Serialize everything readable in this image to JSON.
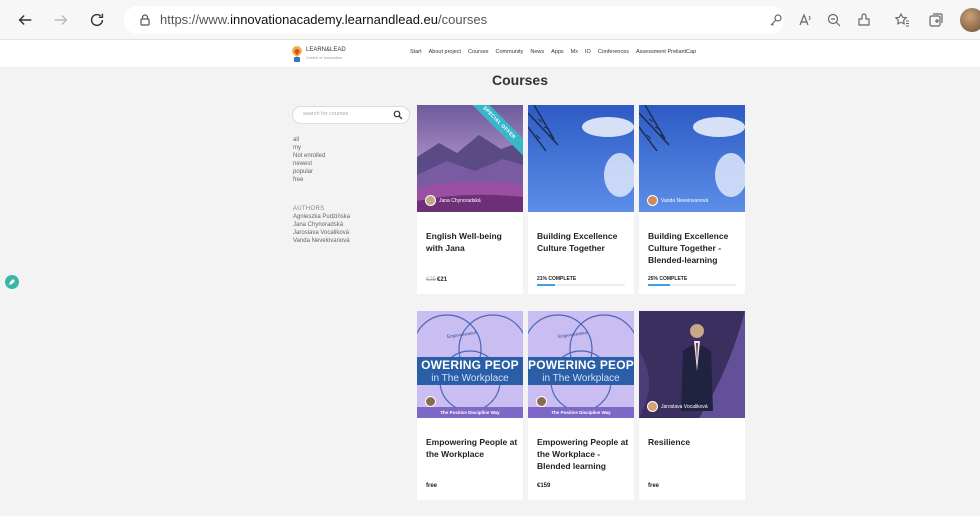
{
  "browser": {
    "url_prefix": "https://www.",
    "url_domain": "innovationacademy.learnandlead.eu",
    "url_path": "/courses"
  },
  "site": {
    "logo_name": "LEARN&LEAD",
    "logo_tagline": "Centre of Innovation",
    "menu": [
      "Start",
      "About project",
      "Courses",
      "Community",
      "News",
      "Apps",
      "Mx",
      "IO",
      "Conferences",
      "Assessment PreliantCap"
    ]
  },
  "page": {
    "title": "Courses",
    "search_placeholder": "search for courses",
    "filters": [
      "all",
      "my",
      "Not enrolled",
      "newest",
      "popular",
      "free"
    ],
    "authors_heading": "AUTHORS",
    "authors": [
      "Agnieszka Pudzińska",
      "Jana Chynoradská",
      "Jaroslava Vocaliková",
      "Vanda Nevelovanová"
    ]
  },
  "courses": [
    {
      "title": "English Well-being with Jana",
      "price_original": "€25",
      "price": "€21",
      "author": "Jana Chynoradská",
      "ribbon": "SPECIAL OFFER"
    },
    {
      "title": "Building Excellence Culture Together",
      "progress_label": "21% COMPLETE",
      "progress": 0.21
    },
    {
      "title": "Building Excellence Culture Together - Blended-learning",
      "progress_label": "25% COMPLETE",
      "progress": 0.25,
      "author": "Vanda Nevelovanová"
    },
    {
      "title": "Empowering People at the Workplace",
      "price": "free",
      "banner1": "OWERING PEOP",
      "banner2": "in The Workplace",
      "banner_foot": "The Positive Discipline Way",
      "circle_label": "Empowerment"
    },
    {
      "title": "Empowering People at the Workplace - Blended learning",
      "price": "€159",
      "banner1": "POWERING PEOP",
      "banner2": "in The Workplace",
      "banner_foot": "The Positive Discipline Way",
      "circle_label": "Empowerment"
    },
    {
      "title": "Resilience",
      "price": "free",
      "author": "Jaroslava Vocaliková"
    }
  ],
  "colors": {
    "accent": "#3fa0e8",
    "ribbon": "#39b6c9",
    "fab": "#3cb7a6",
    "purple": "#7d68c8"
  }
}
